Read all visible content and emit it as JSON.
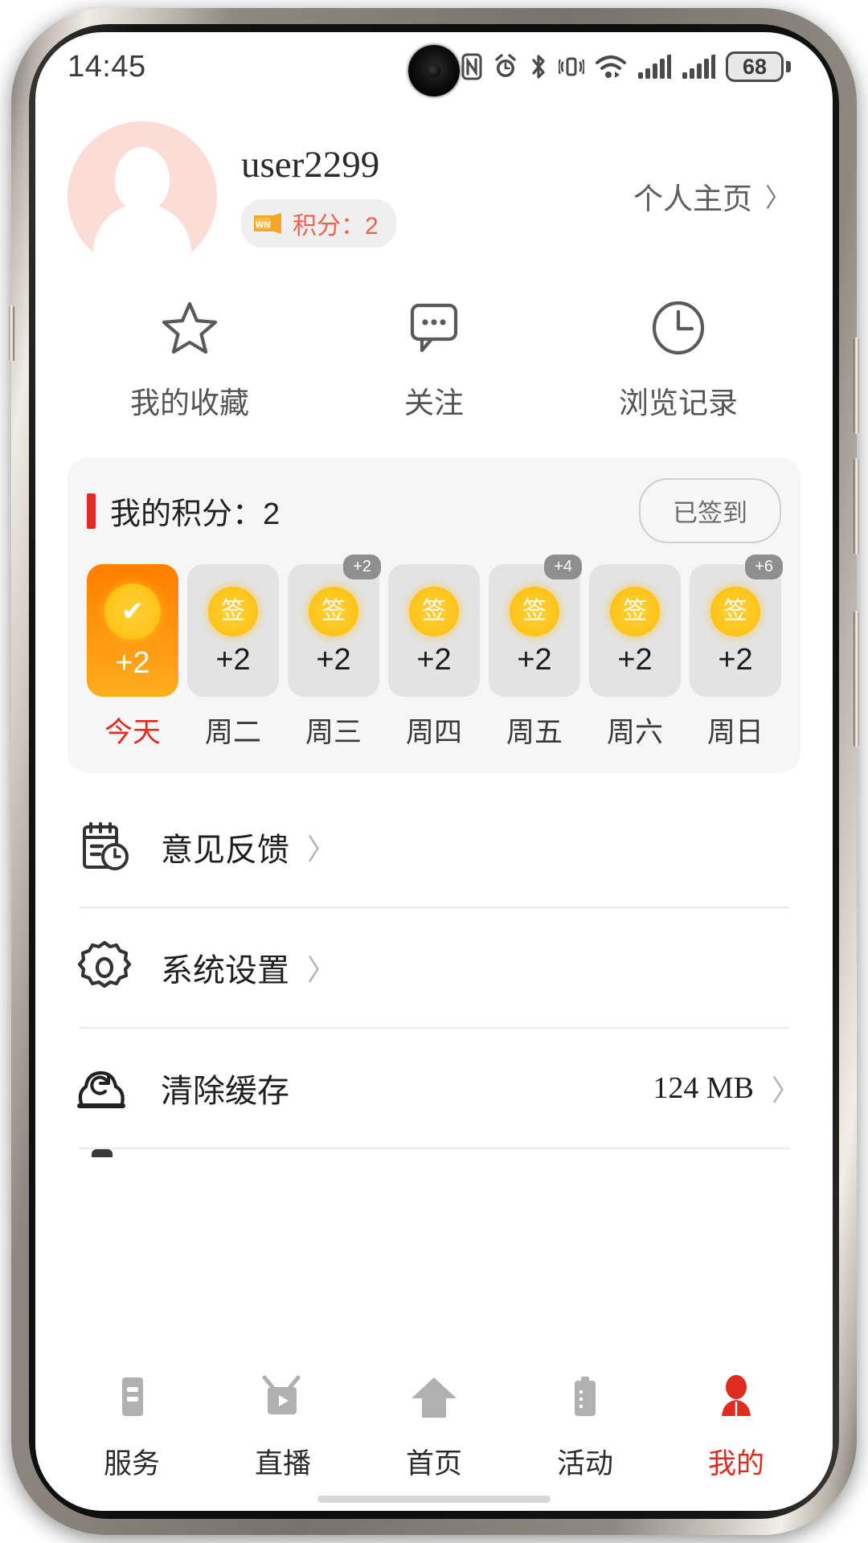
{
  "status_bar": {
    "time": "14:45",
    "battery_percent": "68",
    "icons": [
      "nfc-icon",
      "alarm-icon",
      "bluetooth-icon",
      "vibrate-icon",
      "wifi-icon",
      "signal-1-icon",
      "signal-2-icon",
      "battery-icon"
    ]
  },
  "profile": {
    "username": "user2299",
    "points_badge_label": "积分：2",
    "badge_icon": "wn-ticket-icon",
    "home_link_label": "个人主页",
    "home_link_chevron": "〉",
    "avatar_bg_color": "#fbdcd6"
  },
  "quick_actions": [
    {
      "icon": "star-icon",
      "label": "我的收藏"
    },
    {
      "icon": "chat-bubble-icon",
      "label": "关注"
    },
    {
      "icon": "clock-icon",
      "label": "浏览记录"
    }
  ],
  "points_card": {
    "title": "我的积分：2",
    "accent_color": "#e02b20",
    "signin_button_label": "已签到",
    "days": [
      {
        "name": "今天",
        "points": "+2",
        "badge": "",
        "state": "active",
        "coin_glyph": "✔",
        "today": true
      },
      {
        "name": "周二",
        "points": "+2",
        "badge": "",
        "state": "pending",
        "coin_glyph": "签",
        "today": false
      },
      {
        "name": "周三",
        "points": "+2",
        "badge": "+2",
        "state": "pending",
        "coin_glyph": "签",
        "today": false
      },
      {
        "name": "周四",
        "points": "+2",
        "badge": "",
        "state": "pending",
        "coin_glyph": "签",
        "today": false
      },
      {
        "name": "周五",
        "points": "+2",
        "badge": "+4",
        "state": "pending",
        "coin_glyph": "签",
        "today": false
      },
      {
        "name": "周六",
        "points": "+2",
        "badge": "",
        "state": "pending",
        "coin_glyph": "签",
        "today": false
      },
      {
        "name": "周日",
        "points": "+2",
        "badge": "+6",
        "state": "pending",
        "coin_glyph": "签",
        "today": false
      }
    ]
  },
  "menu": [
    {
      "icon": "feedback-clipboard-icon",
      "label": "意见反馈",
      "value": "",
      "chevron": "〉"
    },
    {
      "icon": "gear-icon",
      "label": "系统设置",
      "value": "",
      "chevron": "〉"
    },
    {
      "icon": "cloud-refresh-icon",
      "label": "清除缓存",
      "value": "124 MB",
      "chevron": "〉"
    }
  ],
  "tabbar": {
    "active_color": "#e02b20",
    "items": [
      {
        "icon": "service-icon",
        "label": "服务",
        "active": false
      },
      {
        "icon": "tv-icon",
        "label": "直播",
        "active": false
      },
      {
        "icon": "home-icon",
        "label": "首页",
        "active": false
      },
      {
        "icon": "activity-clipboard-icon",
        "label": "活动",
        "active": false
      },
      {
        "icon": "person-icon",
        "label": "我的",
        "active": true
      }
    ]
  }
}
